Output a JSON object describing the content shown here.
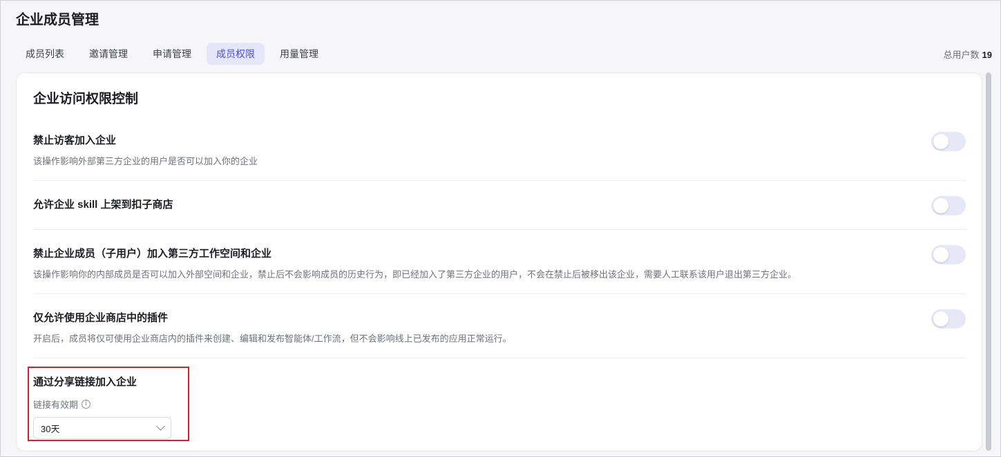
{
  "page": {
    "title": "企业成员管理"
  },
  "tabs": [
    {
      "label": "成员列表",
      "active": false
    },
    {
      "label": "邀请管理",
      "active": false
    },
    {
      "label": "申请管理",
      "active": false
    },
    {
      "label": "成员权限",
      "active": true
    },
    {
      "label": "用量管理",
      "active": false
    }
  ],
  "total": {
    "label": "总用户数",
    "value": "19"
  },
  "section": {
    "title": "企业访问权限控制",
    "settings": [
      {
        "title": "禁止访客加入企业",
        "desc": "该操作影响外部第三方企业的用户是否可以加入你的企业",
        "enabled": false
      },
      {
        "title": "允许企业 skill 上架到扣子商店",
        "desc": "",
        "enabled": false
      },
      {
        "title": "禁止企业成员（子用户）加入第三方工作空间和企业",
        "desc": "该操作影响你的内部成员是否可以加入外部空间和企业，禁止后不会影响成员的历史行为，即已经加入了第三方企业的用户，不会在禁止后被移出该企业，需要人工联系该用户退出第三方企业。",
        "enabled": false
      },
      {
        "title": "仅允许使用企业商店中的插件",
        "desc": "开启后，成员将仅可使用企业商店内的插件来创建、编辑和发布智能体/工作流，但不会影响线上已发布的应用正常运行。",
        "enabled": false
      }
    ],
    "share": {
      "title": "通过分享链接加入企业",
      "label": "链接有效期",
      "selected": "30天"
    }
  },
  "colors": {
    "accent": "#4e4fd9",
    "tab_active_bg": "#e6e6fb",
    "highlight": "#d2202f",
    "toggle_off": "#e7e8f7"
  },
  "icons": {
    "info": "info-icon",
    "chevron": "chevron-down-icon"
  }
}
